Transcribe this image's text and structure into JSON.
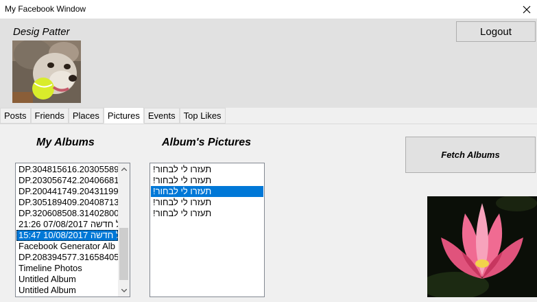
{
  "window": {
    "title": "My Facebook Window",
    "close_icon": "close-icon"
  },
  "header": {
    "user_name": "Desig Patter",
    "logout_label": "Logout",
    "avatar_icon": "dog-with-tennis-ball-photo"
  },
  "tabs": [
    {
      "label": "Posts",
      "active": false
    },
    {
      "label": "Friends",
      "active": false
    },
    {
      "label": "Places",
      "active": false
    },
    {
      "label": "Pictures",
      "active": true
    },
    {
      "label": "Events",
      "active": false
    },
    {
      "label": "Top Likes",
      "active": false
    }
  ],
  "albums": {
    "heading": "My Albums",
    "items": [
      "DP.304815616.20305589",
      "DP.203056742.20406681",
      "DP.200441749.20431199",
      "DP.305189409.20408713",
      "DP.320608508.31402800",
      "21:26 07/08/2017 ל חדשה!",
      "15:47 10/08/2017 ל חדשה!",
      "Facebook Generator Alb",
      "DP.208394577.31658405",
      "Timeline Photos",
      "Untitled Album",
      "Untitled Album"
    ],
    "selected_index": 6,
    "scroll_up_icon": "scroll-up-arrow-icon",
    "scroll_down_icon": "scroll-down-arrow-icon"
  },
  "pictures": {
    "heading": "Album's Pictures",
    "items": [
      "!תעזרו לי לבחור",
      "!תעזרו לי לבחור",
      "!תעזרו לי לבחור",
      "!תעזרו לי לבחור",
      "!תעזרו לי לבחור"
    ],
    "selected_index": 2
  },
  "actions": {
    "fetch_albums_label": "Fetch Albums"
  },
  "preview": {
    "image_icon": "pink-lotus-flower-photo"
  },
  "colors": {
    "selection": "#0078d7",
    "header_bg": "#e1e1e1",
    "window_bg": "#f0f0f0"
  }
}
